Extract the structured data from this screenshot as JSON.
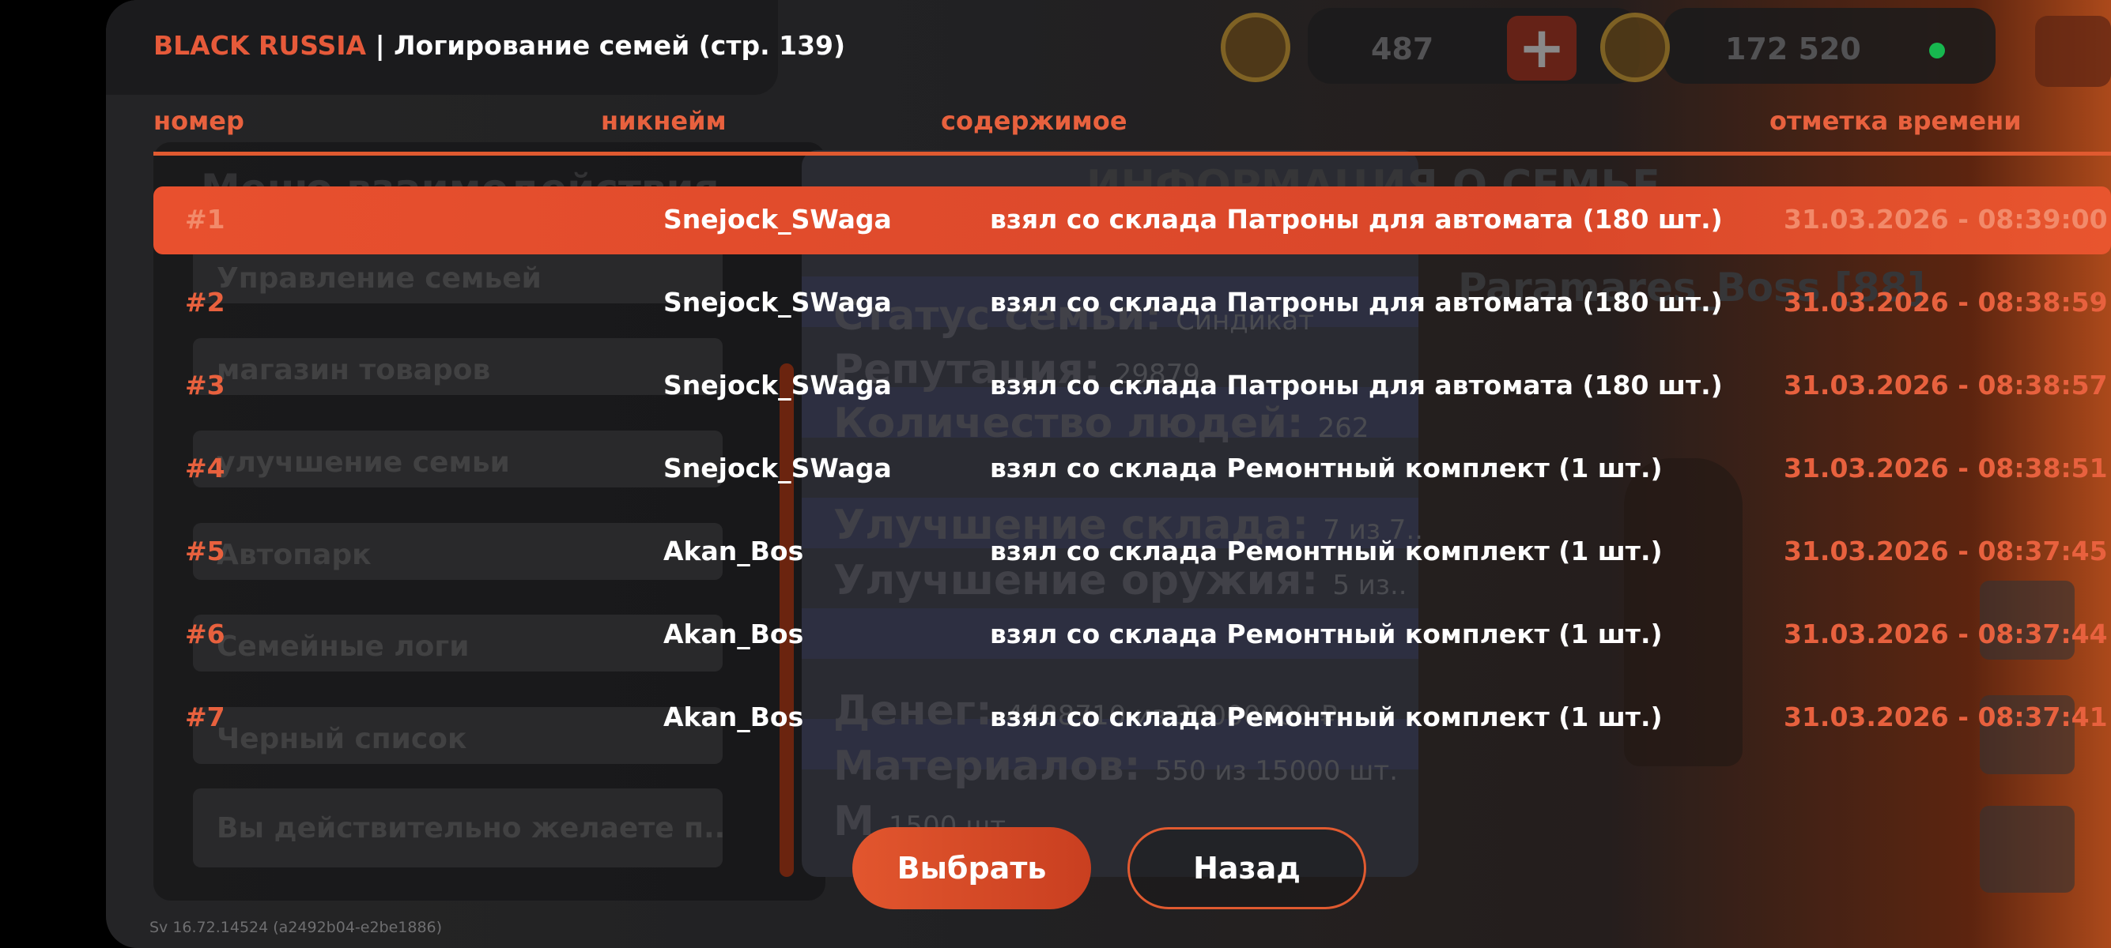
{
  "header": {
    "brand": "BLACK RUSSIA",
    "separator": " | ",
    "title": "Логирование семей (стр. 139)"
  },
  "topbar": {
    "stat1_value": "487",
    "stat2_value": "172 520",
    "star_icon": "star-badge-icon",
    "crown_icon": "crown-badge-icon",
    "plus_icon": "plus-icon",
    "exit_icon": "exit-door-icon",
    "online_color": "#1bd15a"
  },
  "columns": {
    "number": "номер",
    "nickname": "никнейм",
    "content": "содержимое",
    "timestamp": "отметка времени"
  },
  "rows": [
    {
      "num": "#1",
      "nick": "Snejock_SWaga",
      "content": "взял со склада Патроны для автомата (180 шт.)",
      "time": "31.03.2026 - 08:39:00",
      "selected": true
    },
    {
      "num": "#2",
      "nick": "Snejock_SWaga",
      "content": "взял со склада Патроны для автомата (180 шт.)",
      "time": "31.03.2026 - 08:38:59"
    },
    {
      "num": "#3",
      "nick": "Snejock_SWaga",
      "content": "взял со склада Патроны для автомата (180 шт.)",
      "time": "31.03.2026 - 08:38:57"
    },
    {
      "num": "#4",
      "nick": "Snejock_SWaga",
      "content": "взял со склада Ремонтный комплект (1 шт.)",
      "time": "31.03.2026 - 08:38:51"
    },
    {
      "num": "#5",
      "nick": "Akan_Bos",
      "content": "взял со склада Ремонтный комплект (1 шт.)",
      "time": "31.03.2026 - 08:37:45"
    },
    {
      "num": "#6",
      "nick": "Akan_Bos",
      "content": "взял со склада Ремонтный комплект (1 шт.)",
      "time": "31.03.2026 - 08:37:44"
    },
    {
      "num": "#7",
      "nick": "Akan_Bos",
      "content": "взял со склада Ремонтный комплект (1 шт.)",
      "time": "31.03.2026 - 08:37:41"
    }
  ],
  "buttons": {
    "select": "Выбрать",
    "back": "Назад"
  },
  "background": {
    "menu_title": "Меню взаимодействия",
    "menu_items": [
      "Управление семьей",
      "магазин товаров",
      "улучшение семьи",
      "Автопарк",
      "Семейные логи",
      "Черный список",
      "Вы действительно желаете п..."
    ],
    "info_header": "ИНФОРМАЦИЯ О СЕМЬЕ",
    "boss": "Paramares_Boss [88]",
    "info": [
      {
        "label": "Статус семьи:",
        "value": "Синдикат"
      },
      {
        "label": "Репутация:",
        "value": "29879"
      },
      {
        "label": "Количество людей:",
        "value": "262"
      },
      {
        "label": "Улучшение склада:",
        "value": "7 из 7.."
      },
      {
        "label": "Улучшение оружия:",
        "value": "5 из.."
      },
      {
        "label": "Денег:",
        "value": "4488710 из 30000000 ₽"
      },
      {
        "label": "Материалов:",
        "value": "550 из 15000 шт."
      },
      {
        "label": "М",
        "value": "1500 шт."
      }
    ]
  },
  "version": "Sv 16.72.14524 (a2492b04-e2be1886)"
}
